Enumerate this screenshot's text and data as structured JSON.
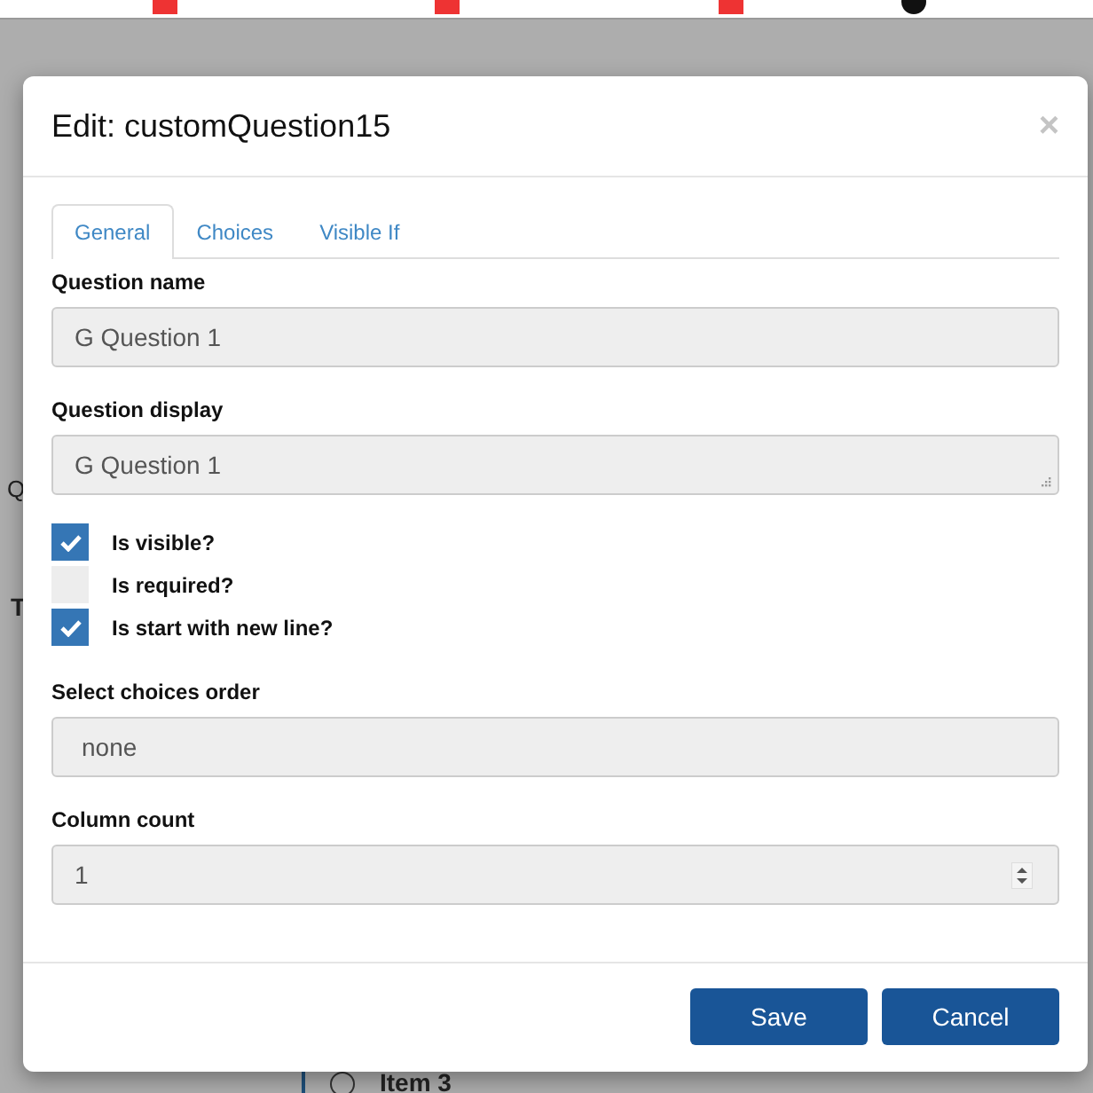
{
  "bookmarks": [
    {
      "kind": "plain"
    },
    {
      "kind": "lemo"
    },
    {
      "kind": "lemo"
    },
    {
      "kind": "lemo"
    },
    {
      "kind": "dark"
    }
  ],
  "background": {
    "texts": [
      "Q",
      "T"
    ],
    "choice": {
      "label": "Item 3",
      "selected": false
    }
  },
  "modal": {
    "title": "Edit: customQuestion15",
    "close": "×",
    "tabs": [
      {
        "label": "General",
        "selected": true
      },
      {
        "label": "Choices",
        "selected": false
      },
      {
        "label": "Visible If",
        "selected": false
      }
    ],
    "fields": [
      {
        "kind": "text",
        "label": "Question name",
        "value": "G Question 1"
      },
      {
        "kind": "textarea",
        "label": "Question display",
        "value": "G Question 1"
      },
      {
        "kind": "checks",
        "items": [
          {
            "label": "Is visible?",
            "checked": true
          },
          {
            "label": "Is required?",
            "checked": false
          },
          {
            "label": "Is start with new line?",
            "checked": true
          }
        ]
      },
      {
        "kind": "select",
        "label": "Select choices order",
        "value": "none"
      },
      {
        "kind": "number",
        "label": "Column count",
        "value": "1"
      }
    ],
    "buttons": [
      "Save",
      "Cancel"
    ]
  }
}
